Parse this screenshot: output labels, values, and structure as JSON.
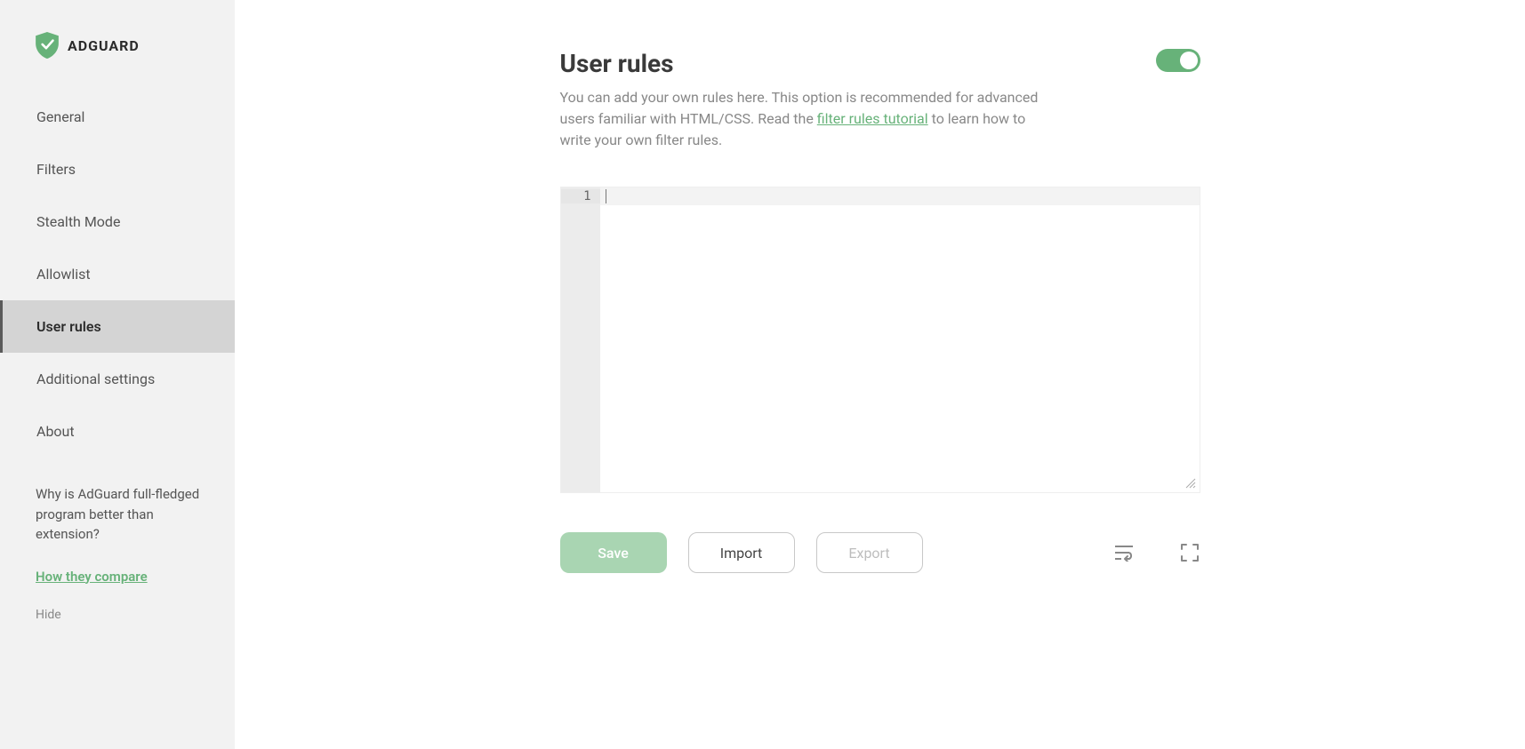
{
  "brand": {
    "name": "ADGUARD"
  },
  "sidebar": {
    "items": [
      {
        "label": "General"
      },
      {
        "label": "Filters"
      },
      {
        "label": "Stealth Mode"
      },
      {
        "label": "Allowlist"
      },
      {
        "label": "User rules"
      },
      {
        "label": "Additional settings"
      },
      {
        "label": "About"
      }
    ],
    "active_index": 4,
    "promo": {
      "text": "Why is AdGuard full-fledged program better than extension?",
      "link_label": "How they compare",
      "hide_label": "Hide"
    }
  },
  "page": {
    "title": "User rules",
    "toggle_state": "on",
    "description_pre": "You can add your own rules here. This option is recommended for advanced users familiar with HTML/CSS. Read the ",
    "description_link": "filter rules tutorial",
    "description_post": " to learn how to write your own filter rules."
  },
  "editor": {
    "line_numbers": [
      "1"
    ],
    "content": ""
  },
  "actions": {
    "save": "Save",
    "import": "Import",
    "export": "Export",
    "save_enabled": false,
    "export_enabled": false
  },
  "icons": {
    "wrap": "wrap-lines-icon",
    "fullscreen": "fullscreen-icon"
  }
}
